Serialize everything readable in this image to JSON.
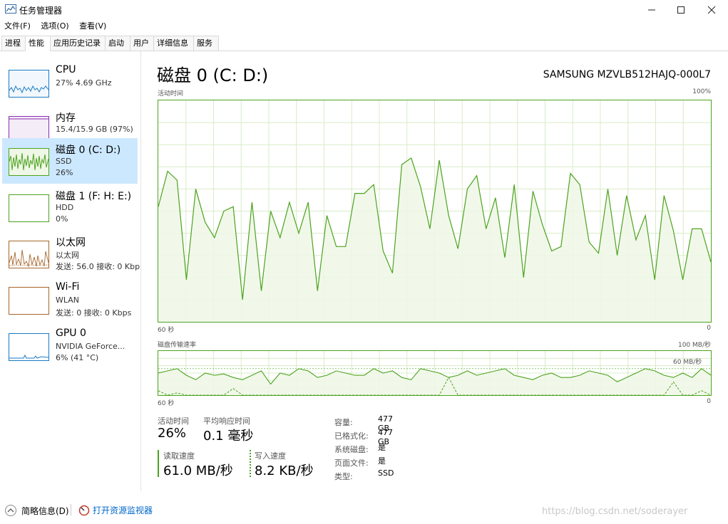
{
  "window": {
    "title": "任务管理器"
  },
  "menu": [
    "文件(F)",
    "选项(O)",
    "查看(V)"
  ],
  "tabs": [
    "进程",
    "性能",
    "应用历史记录",
    "启动",
    "用户",
    "详细信息",
    "服务"
  ],
  "active_tab": "性能",
  "sidebar": {
    "items": [
      {
        "title": "CPU",
        "line2": "27% 4.69 GHz",
        "line3": "",
        "color": "#1a7ac4"
      },
      {
        "title": "内存",
        "line2": "15.4/15.9 GB (97%)",
        "line3": "",
        "color": "#8b2cb0"
      },
      {
        "title": "磁盘 0 (C: D:)",
        "line2": "SSD",
        "line3": "26%",
        "color": "#4ca31e",
        "selected": true
      },
      {
        "title": "磁盘 1 (F: H: E:)",
        "line2": "HDD",
        "line3": "0%",
        "color": "#4ca31e"
      },
      {
        "title": "以太网",
        "line2": "以太网",
        "line3": "发送: 56.0  接收: 0 Kbp",
        "color": "#a7652b"
      },
      {
        "title": "Wi-Fi",
        "line2": "WLAN",
        "line3": "发送: 0  接收: 0 Kbps",
        "color": "#a7652b"
      },
      {
        "title": "GPU 0",
        "line2": "NVIDIA GeForce...",
        "line3": "6% (41 °C)",
        "color": "#1a7ac4"
      }
    ]
  },
  "main": {
    "title": "磁盘 0 (C: D:)",
    "model": "SAMSUNG MZVLB512HAJQ-000L7",
    "graph1": {
      "label": "活动时间",
      "max_label": "100%",
      "left_bottom": "60 秒",
      "right_bottom": "0"
    },
    "graph2": {
      "label": "磁盘传输速率",
      "max_label": "100 MB/秒",
      "inner_label": "60 MB/秒",
      "left_bottom": "60 秒",
      "right_bottom": "0"
    },
    "stats": {
      "active_time_label": "活动时间",
      "active_time": "26%",
      "response_label": "平均响应时间",
      "response": "0.1 毫秒",
      "read_label": "读取速度",
      "read": "61.0 MB/秒",
      "write_label": "写入速度",
      "write": "8.2 KB/秒"
    },
    "info": [
      {
        "label": "容量:",
        "value": "477 GB"
      },
      {
        "label": "已格式化:",
        "value": "477 GB"
      },
      {
        "label": "系统磁盘:",
        "value": "是"
      },
      {
        "label": "页面文件:",
        "value": "是"
      },
      {
        "label": "类型:",
        "value": "SSD"
      }
    ]
  },
  "footer": {
    "summary": "简略信息(D)",
    "monitor": "打开资源监视器"
  },
  "watermark": "https://blog.csdn.net/soderayer",
  "chart_data": {
    "type": "area",
    "title": "活动时间",
    "ylim": [
      0,
      100
    ],
    "series": [
      {
        "values": [
          52,
          68,
          64,
          19,
          60,
          45,
          38,
          50,
          52,
          10,
          54,
          14,
          50,
          38,
          54,
          40,
          54,
          14,
          48,
          34,
          34,
          58,
          58,
          62,
          32,
          22,
          71,
          74,
          61,
          42,
          73,
          48,
          33,
          60,
          66,
          42,
          56,
          29,
          62,
          20,
          59,
          44,
          32,
          34,
          67,
          62,
          36,
          31,
          60,
          30,
          57,
          37,
          48,
          19,
          57,
          41,
          19,
          42,
          42,
          27
        ]
      }
    ],
    "xlim": [
      60,
      0
    ]
  },
  "chart_data_transfer": {
    "read": [
      50,
      55,
      60,
      45,
      35,
      50,
      45,
      48,
      40,
      35,
      45,
      55,
      25,
      50,
      45,
      60,
      55,
      40,
      45,
      55,
      50,
      45,
      45,
      60,
      50,
      55,
      40,
      35,
      60,
      55,
      50,
      40,
      45,
      55,
      45,
      50,
      55,
      60,
      45,
      40,
      35,
      45,
      50,
      40,
      40,
      45,
      55,
      50,
      45,
      30,
      40,
      50,
      60,
      55,
      45,
      40,
      50,
      40,
      60,
      45
    ],
    "write": [
      10,
      0,
      5,
      0,
      0,
      0,
      0,
      0,
      15,
      0,
      0,
      0,
      0,
      0,
      0,
      0,
      0,
      0,
      0,
      0,
      0,
      0,
      0,
      0,
      0,
      0,
      0,
      0,
      0,
      0,
      0,
      40,
      0,
      0,
      0,
      0,
      0,
      0,
      0,
      0,
      0,
      0,
      0,
      0,
      0,
      0,
      0,
      0,
      0,
      0,
      0,
      0,
      0,
      0,
      0,
      30,
      0,
      0,
      10,
      0
    ],
    "ylim": [
      0,
      100
    ]
  },
  "colors": {
    "disk": "#4ca31e",
    "disk_fill": "#eff7e6",
    "grid": "#d8ecc8",
    "selected_bg": "#cce8ff",
    "link": "#0066cc"
  }
}
